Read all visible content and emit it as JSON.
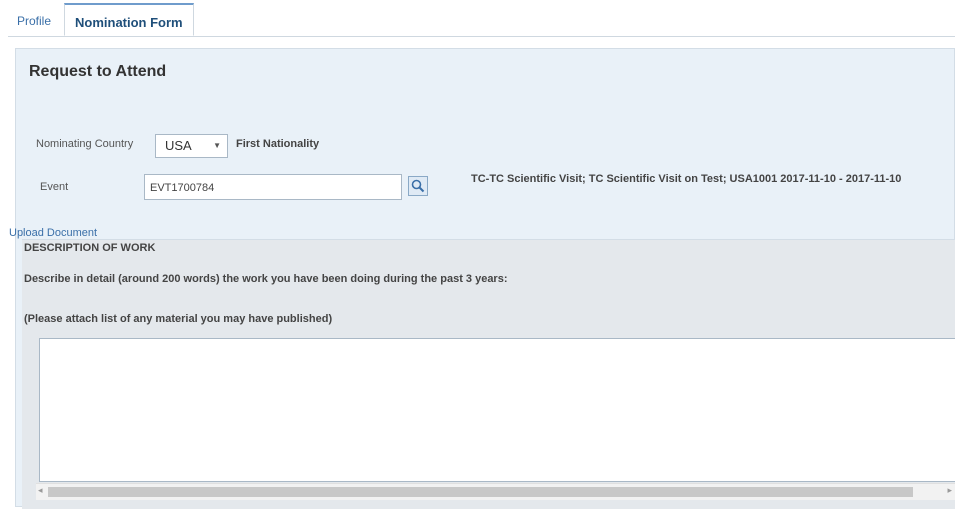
{
  "tabs": [
    {
      "label": "Profile"
    },
    {
      "label": "Nomination Form"
    }
  ],
  "page": {
    "title": "Request to Attend"
  },
  "form": {
    "nominating_country_label": "Nominating Country",
    "country_value": "USA",
    "first_nationality_label": "First Nationality",
    "event_label": "Event",
    "event_value": "EVT1700784",
    "event_description": "TC-TC Scientific Visit; TC Scientific Visit on Test; USA1001 2017-11-10 - 2017-11-10",
    "upload_link": "Upload Document"
  },
  "description": {
    "heading": "DESCRIPTION OF WORK",
    "instruction": "Describe in detail (around 200 words) the work you have been doing during the past 3 years:",
    "note": "(Please attach list of any material you may have published)",
    "text_value": ""
  },
  "icons": {
    "search": "search-icon",
    "dropdown": "chevron-down-icon"
  }
}
